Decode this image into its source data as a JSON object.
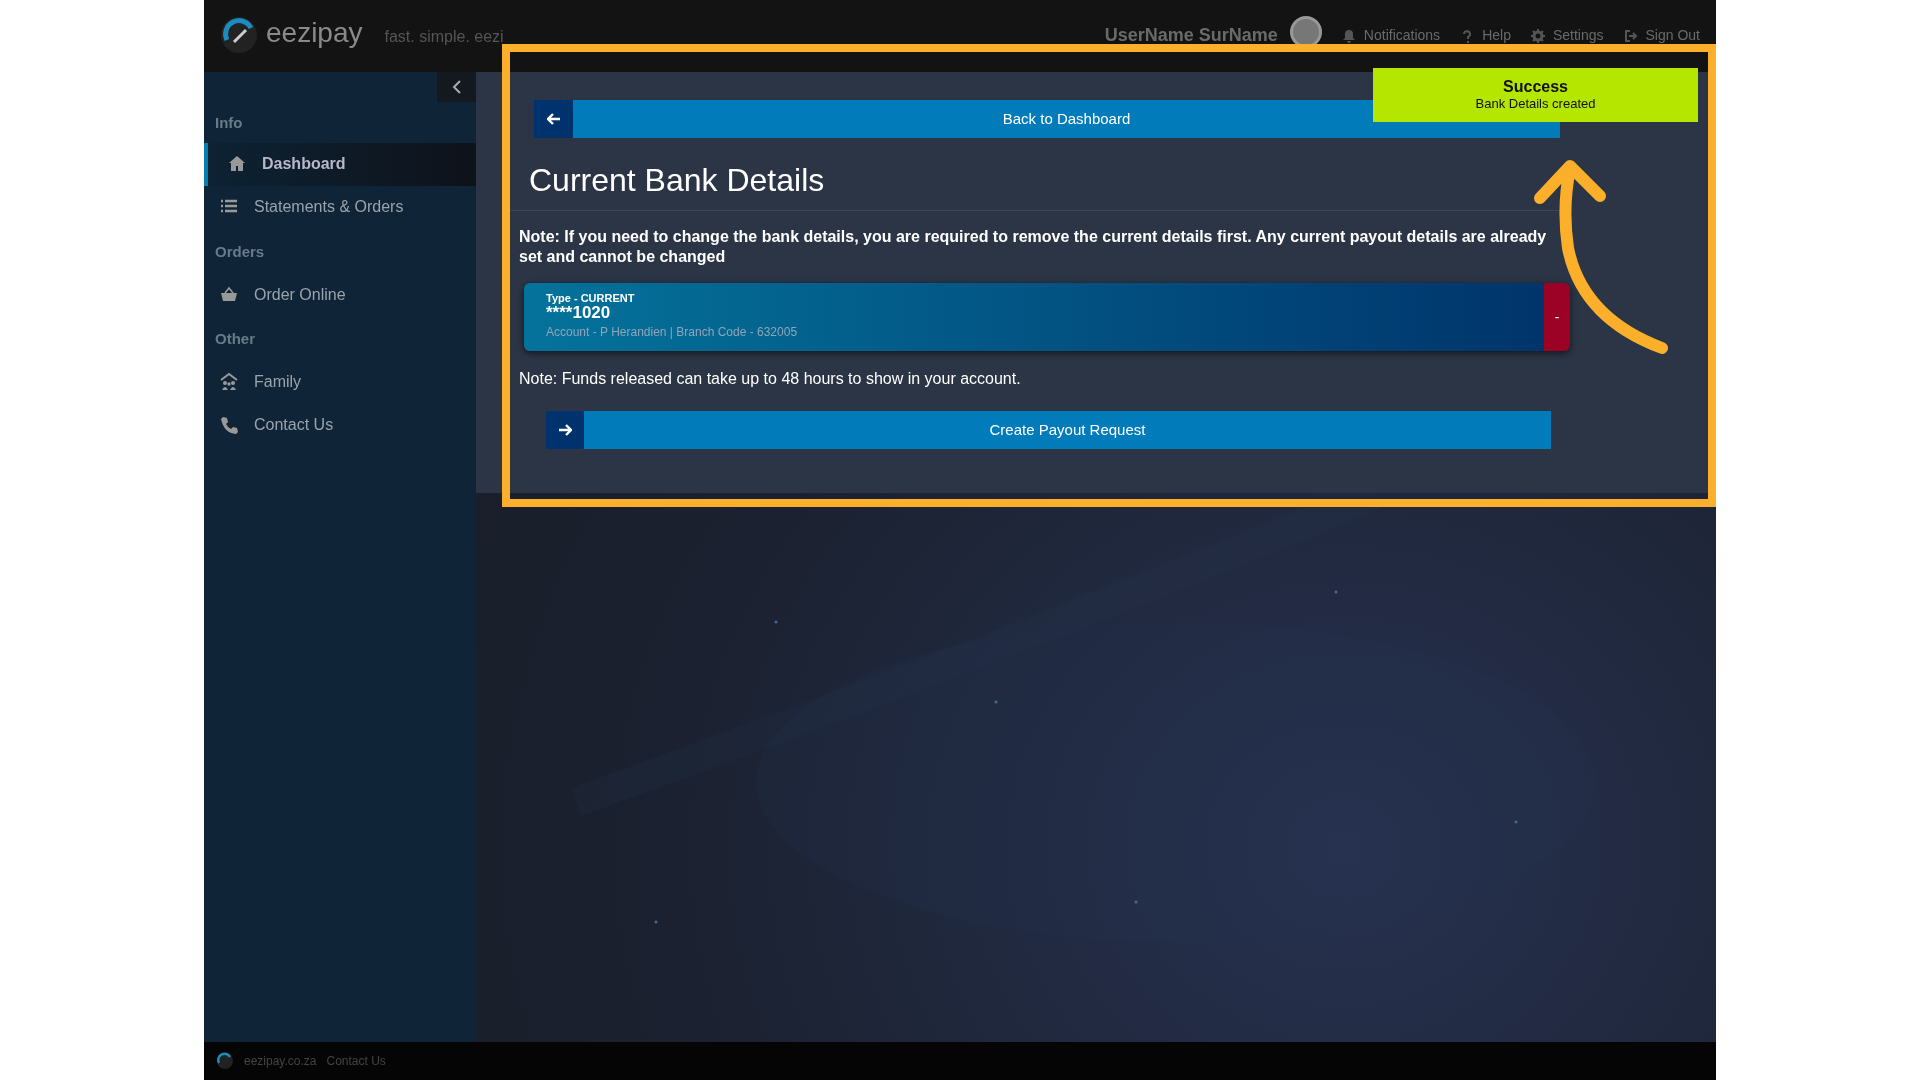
{
  "header": {
    "brand": "eezipay",
    "tagline": "fast. simple. eezi",
    "user_name": "UserName SurName",
    "links": [
      {
        "label": "Notifications",
        "kind": "bell"
      },
      {
        "label": "Help",
        "kind": "help"
      },
      {
        "label": "Settings",
        "kind": "gear"
      },
      {
        "label": "Sign Out",
        "kind": "signout"
      }
    ]
  },
  "sidebar": {
    "sections": [
      {
        "title": "Info",
        "items": [
          {
            "label": "Dashboard",
            "kind": "home",
            "selected": true
          },
          {
            "label": "Statements & Orders",
            "kind": "list",
            "selected": false
          }
        ]
      },
      {
        "title": "Orders",
        "items": [
          {
            "label": "Order Online",
            "kind": "basket",
            "selected": false
          }
        ]
      },
      {
        "title": "Other",
        "items": [
          {
            "label": "Family",
            "kind": "family",
            "selected": false
          },
          {
            "label": "Contact Us",
            "kind": "phone",
            "selected": false
          }
        ]
      }
    ]
  },
  "main": {
    "back_button": "Back to Dashboard",
    "title": "Current Bank Details",
    "note": "Note: If you need to change the bank details, you are required to remove the current details first. Any current payout details are already set and cannot be changed",
    "bank_card": {
      "type": "Type - CURRENT",
      "number": "****1020",
      "details": "Account - P Herandien | Branch Code - 632005",
      "remove": "-"
    },
    "funds_note": "Note: Funds released can take up to 48 hours to show in your account.",
    "payout_button": "Create Payout Request"
  },
  "toast": {
    "title": "Success",
    "message": "Bank Details created"
  },
  "footer": {
    "site": "eezipay.co.za",
    "link": "Contact Us"
  }
}
